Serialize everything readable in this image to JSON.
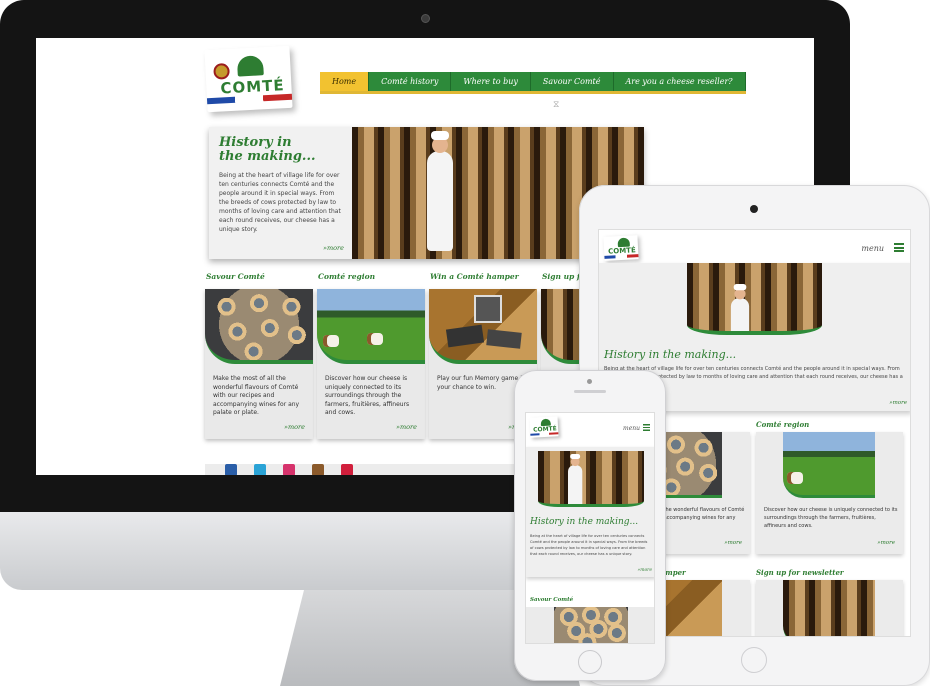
{
  "desktop": {
    "logo_text": "COMTÉ",
    "nav": [
      "Home",
      "Comté history",
      "Where to buy",
      "Savour Comté",
      "Are you a cheese reseller?"
    ],
    "loader": "⧖",
    "hero": {
      "title": "History in the making...",
      "text": "Being at the heart of village life for over ten centuries connects Comté and the people around it in special ways. From the breeds of cows protected by law to months of loving care and attention that each round receives, our cheese has a unique story.",
      "more": "»more"
    },
    "cards": [
      {
        "title": "Savour Comté",
        "text": "Make the most of all the wonderful flavours of Comté with our recipes and accompanying wines for any palate or plate.",
        "more": "»more"
      },
      {
        "title": "Comté region",
        "text": "Discover how our cheese is uniquely connected to its surroundings through the farmers, fruitières, affineurs and cows.",
        "more": "»more"
      },
      {
        "title": "Win a Comté hamper",
        "text": "Play our fun Memory game for your chance to win.",
        "more": "»more"
      },
      {
        "title": "Sign up for"
      }
    ],
    "social_colors": [
      "#2a5ea8",
      "#2aa3d6",
      "#d6336c",
      "#8b5a2b",
      "#d11f3c"
    ]
  },
  "tablet": {
    "logo_text": "COMTÉ",
    "menu_label": "menu",
    "hero": {
      "title": "History in the making...",
      "text": "Being at the heart of village life for over ten centuries connects Comté and the people around it in special ways. From the breeds of cows protected by law to months of loving care and attention that each round receives, our cheese has a unique story.",
      "more": "»more"
    },
    "cards": [
      {
        "title": "Savour Comté",
        "text": "Make the most of all the wonderful flavours of Comté with our recipes and accompanying wines for any palate or plate.",
        "more": "»more"
      },
      {
        "title": "Comté region",
        "text": "Discover how our cheese is uniquely connected to its surroundings through the farmers, fruitières, affineurs and cows.",
        "more": "»more"
      },
      {
        "title": "Win a Comté hamper"
      },
      {
        "title": "Sign up for newsletter"
      }
    ]
  },
  "phone": {
    "logo_text": "COMTÉ",
    "menu_label": "menu",
    "hero": {
      "title": "History in the making...",
      "text": "Being at the heart of village life for over ten centuries connects Comté and the people around it in special ways. From the breeds of cows protected by law to months of loving care and attention that each round receives, our cheese has a unique story.",
      "more": "»more"
    },
    "card_title": "Savour Comté"
  },
  "colors": {
    "brand_green": "#2e7d32",
    "nav_green": "#2d8a3a",
    "nav_active": "#f2c230"
  }
}
